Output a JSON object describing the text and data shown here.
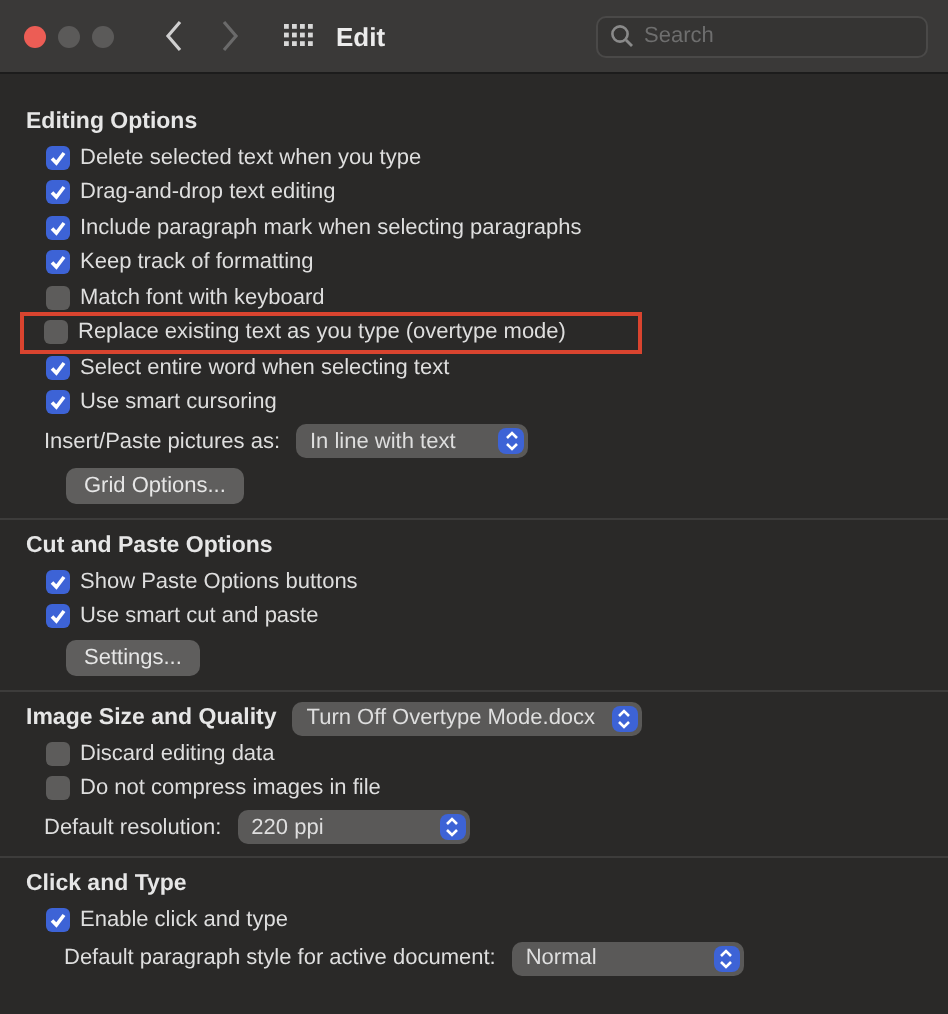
{
  "window": {
    "title": "Edit",
    "search": {
      "placeholder": "Search"
    }
  },
  "sections": [
    {
      "title": "Editing Options",
      "items": [
        {
          "kind": "checkbox",
          "label": "Delete selected text when you type",
          "checked": true,
          "highlighted": false
        },
        {
          "kind": "checkbox",
          "label": "Drag-and-drop text editing",
          "checked": true,
          "highlighted": false
        },
        {
          "kind": "checkbox",
          "label": "Include paragraph mark when selecting paragraphs",
          "checked": true,
          "highlighted": false
        },
        {
          "kind": "checkbox",
          "label": "Keep track of formatting",
          "checked": true,
          "highlighted": false
        },
        {
          "kind": "checkbox",
          "label": "Match font with keyboard",
          "checked": false,
          "highlighted": false
        },
        {
          "kind": "checkbox",
          "label": "Replace existing text as you type (overtype mode)",
          "checked": false,
          "highlighted": true
        },
        {
          "kind": "checkbox",
          "label": "Select entire word when selecting text",
          "checked": true,
          "highlighted": false
        },
        {
          "kind": "checkbox",
          "label": "Use smart cursoring",
          "checked": true,
          "highlighted": false
        },
        {
          "kind": "select",
          "label": "Insert/Paste pictures as:",
          "value": "In line with text"
        },
        {
          "kind": "button",
          "label": "Grid Options..."
        }
      ]
    },
    {
      "title": "Cut and Paste Options",
      "items": [
        {
          "kind": "checkbox",
          "label": "Show Paste Options buttons",
          "checked": true,
          "highlighted": false
        },
        {
          "kind": "checkbox",
          "label": "Use smart cut and paste",
          "checked": true,
          "highlighted": false
        },
        {
          "kind": "button",
          "label": "Settings..."
        }
      ]
    },
    {
      "title": "Image Size and Quality",
      "select": "Turn Off Overtype Mode.docx",
      "items": [
        {
          "kind": "checkbox",
          "label": "Discard editing data",
          "checked": false,
          "highlighted": false
        },
        {
          "kind": "checkbox",
          "label": "Do not compress images in file",
          "checked": false,
          "highlighted": false
        },
        {
          "kind": "select",
          "label": "Default resolution:",
          "value": "220 ppi"
        }
      ]
    },
    {
      "title": "Click and Type",
      "items": [
        {
          "kind": "checkbox",
          "label": "Enable click and type",
          "checked": true,
          "highlighted": false
        },
        {
          "kind": "select",
          "label": "Default paragraph style for active document:",
          "value": "Normal",
          "indent": true
        }
      ]
    }
  ]
}
